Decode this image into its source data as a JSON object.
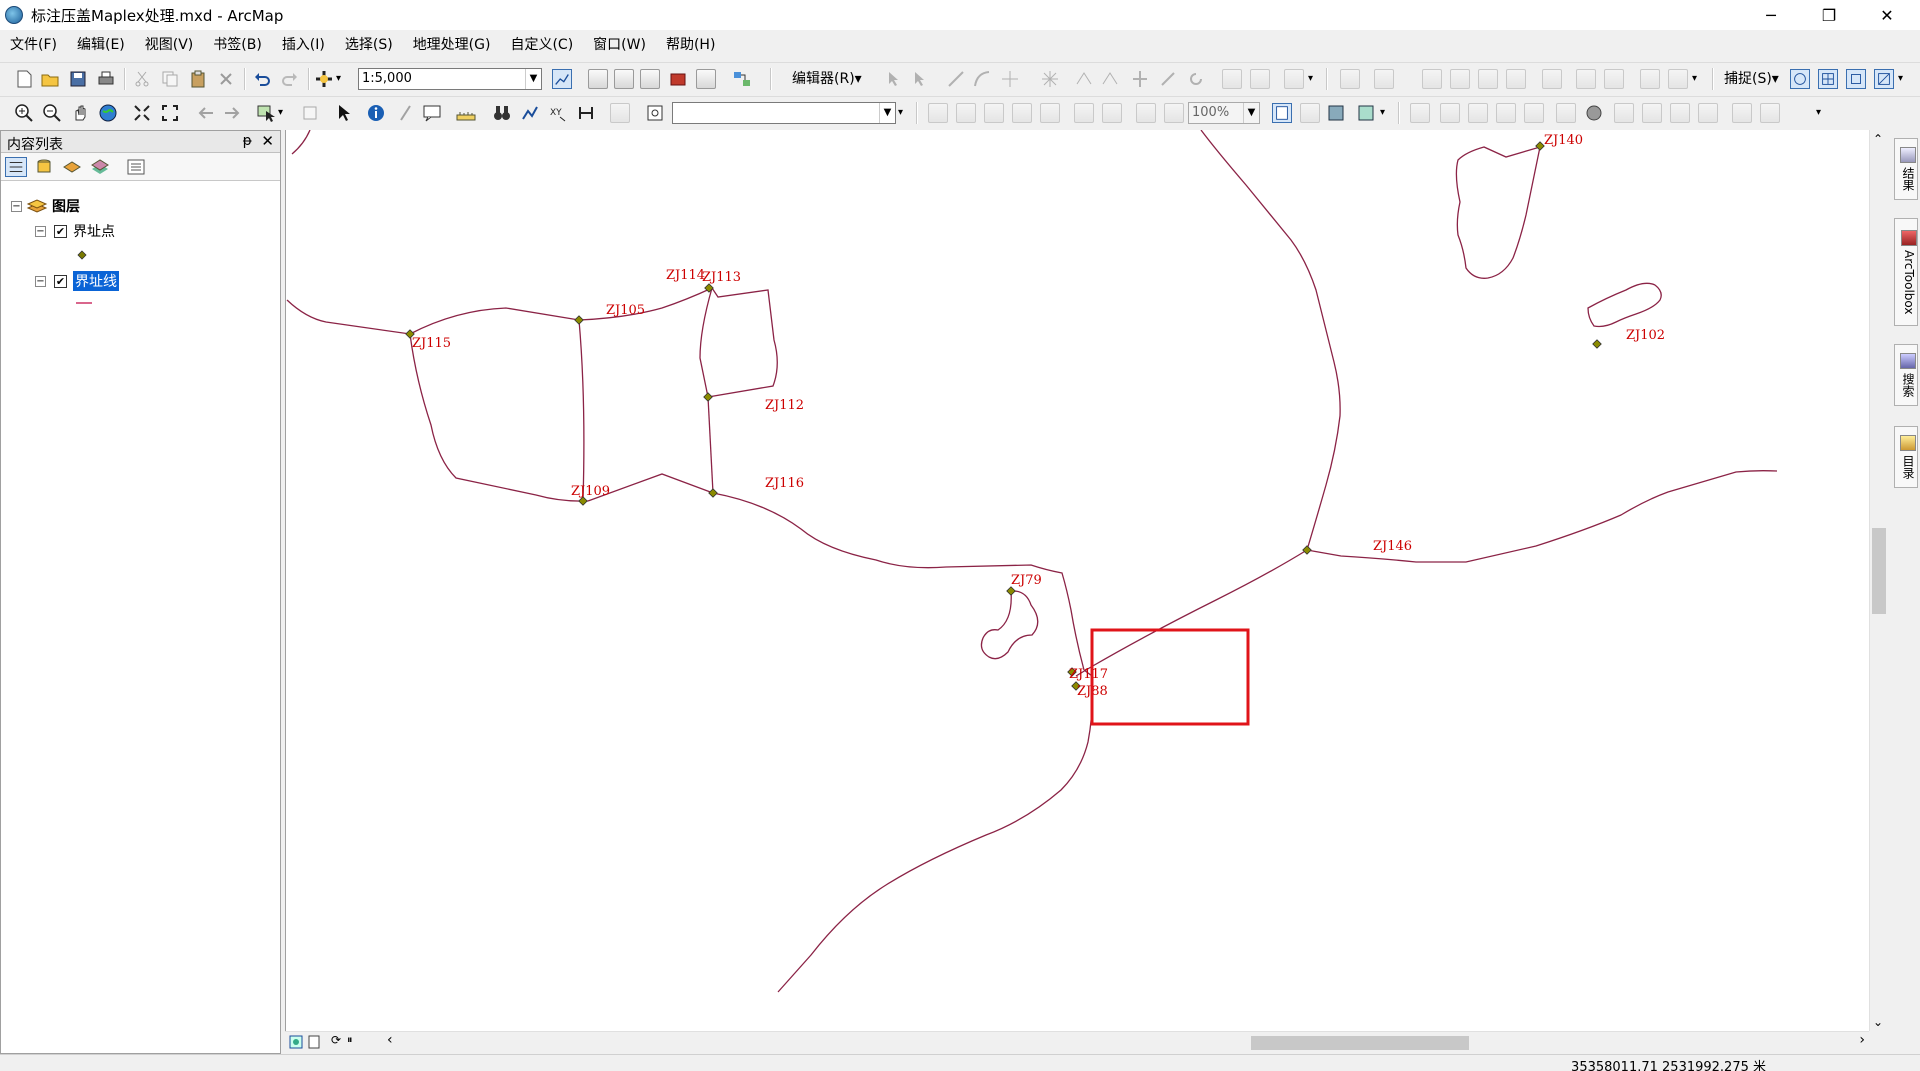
{
  "window": {
    "title": "标注压盖Maplex处理.mxd - ArcMap",
    "minimize_glyph": "─",
    "maximize_glyph": "❐",
    "close_glyph": "✕"
  },
  "menu": [
    "文件(F)",
    "编辑(E)",
    "视图(V)",
    "书签(B)",
    "插入(I)",
    "选择(S)",
    "地理处理(G)",
    "自定义(C)",
    "窗口(W)",
    "帮助(H)"
  ],
  "toolbar": {
    "scale_value": "1:5,000",
    "editor_label": "编辑器(R)▾",
    "snapping_label": "捕捉(S)▾",
    "zoom_value": "100%",
    "layer_combo_value": ""
  },
  "toc": {
    "title": "内容列表",
    "pin_glyph": "ᵽ",
    "close_glyph": "✕",
    "root_label": "图层",
    "layers": [
      {
        "label": "界址点",
        "checked": true,
        "symbol": "point",
        "symbol_color": "#7a7a00"
      },
      {
        "label": "界址线",
        "checked": true,
        "symbol": "line",
        "symbol_color": "#cc3366",
        "selected": true
      }
    ]
  },
  "map": {
    "line_color": "#8b2346",
    "point_color": "#8b8b00",
    "label_color": "#cc0000",
    "highlight_color": "#e0141a",
    "labels": [
      "ZJ140",
      "ZJ114",
      "ZJ113",
      "ZJ105",
      "ZJ115",
      "ZJ102",
      "ZJ112",
      "ZJ109",
      "ZJ116",
      "ZJ146",
      "ZJ79",
      "ZJ117",
      "ZJ88"
    ]
  },
  "right_dock": {
    "tabs": [
      "结果",
      "ArcToolbox",
      "搜索",
      "目录"
    ]
  },
  "status": {
    "coordinates": "35358011.71  2531992.275 米"
  },
  "colors": {
    "selection_blue": "#0a64d6",
    "chrome": "#f0f0f0"
  }
}
